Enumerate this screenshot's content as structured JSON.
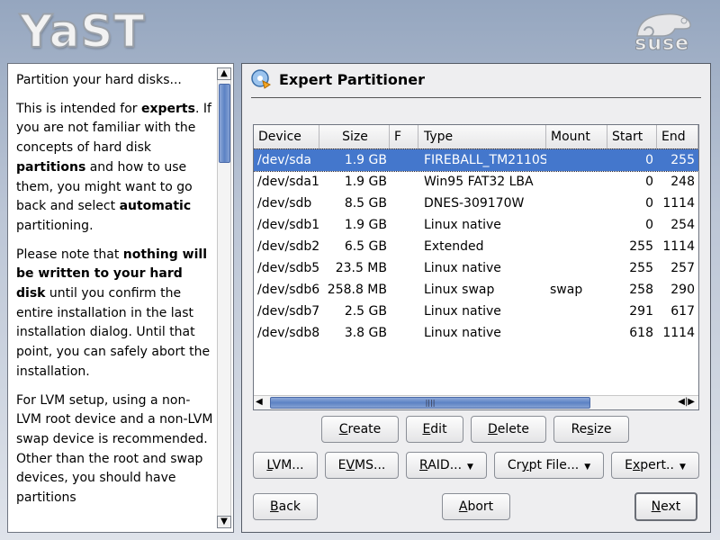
{
  "brand": {
    "logo": "YaST",
    "vendor": "suse"
  },
  "help": {
    "paragraphs": [
      [
        {
          "t": "Partition your hard disks..."
        }
      ],
      [
        {
          "t": "This is intended for "
        },
        {
          "t": "experts",
          "b": true
        },
        {
          "t": ". If you are not familiar with the concepts of hard disk "
        },
        {
          "t": "partitions",
          "b": true
        },
        {
          "t": " and how to use them, you might want to go back and select "
        },
        {
          "t": "automatic",
          "b": true
        },
        {
          "t": " partitioning."
        }
      ],
      [
        {
          "t": "Please note that "
        },
        {
          "t": "nothing will be written to your hard disk",
          "b": true
        },
        {
          "t": " until you confirm the entire installation in the last installation dialog. Until that point, you can safely abort the installation."
        }
      ],
      [
        {
          "t": "For LVM setup, using a non-LVM root device and a non-LVM swap device is recommended. Other than the root and swap devices, you should have partitions"
        }
      ]
    ]
  },
  "dialog": {
    "title": "Expert Partitioner",
    "columns": [
      "Device",
      "Size",
      "F",
      "Type",
      "Mount",
      "Start",
      "End"
    ],
    "rows": [
      {
        "device": "/dev/sda",
        "size": "1.9 GB",
        "f": "",
        "type": "FIREBALL_TM2110S",
        "mount": "",
        "start": "0",
        "end": "255",
        "selected": true
      },
      {
        "device": "/dev/sda1",
        "size": "1.9 GB",
        "f": "",
        "type": "Win95 FAT32 LBA",
        "mount": "",
        "start": "0",
        "end": "248"
      },
      {
        "device": "/dev/sdb",
        "size": "8.5 GB",
        "f": "",
        "type": "DNES-309170W",
        "mount": "",
        "start": "0",
        "end": "1114"
      },
      {
        "device": "/dev/sdb1",
        "size": "1.9 GB",
        "f": "",
        "type": "Linux native",
        "mount": "",
        "start": "0",
        "end": "254"
      },
      {
        "device": "/dev/sdb2",
        "size": "6.5 GB",
        "f": "",
        "type": "Extended",
        "mount": "",
        "start": "255",
        "end": "1114"
      },
      {
        "device": "/dev/sdb5",
        "size": "23.5 MB",
        "f": "",
        "type": "Linux native",
        "mount": "",
        "start": "255",
        "end": "257"
      },
      {
        "device": "/dev/sdb6",
        "size": "258.8 MB",
        "f": "",
        "type": "Linux swap",
        "mount": "swap",
        "start": "258",
        "end": "290"
      },
      {
        "device": "/dev/sdb7",
        "size": "2.5 GB",
        "f": "",
        "type": "Linux native",
        "mount": "",
        "start": "291",
        "end": "617"
      },
      {
        "device": "/dev/sdb8",
        "size": "3.8 GB",
        "f": "",
        "type": "Linux native",
        "mount": "",
        "start": "618",
        "end": "1114"
      }
    ],
    "buttons": {
      "create": {
        "pre": "",
        "u": "C",
        "post": "reate"
      },
      "edit": {
        "pre": "",
        "u": "E",
        "post": "dit"
      },
      "delete": {
        "pre": "",
        "u": "D",
        "post": "elete"
      },
      "resize": {
        "pre": "Re",
        "u": "s",
        "post": "ize"
      },
      "lvm": {
        "pre": "",
        "u": "L",
        "post": "VM..."
      },
      "evms": {
        "pre": "E",
        "u": "V",
        "post": "MS..."
      },
      "raid": {
        "pre": "",
        "u": "R",
        "post": "AID..."
      },
      "crypt": {
        "pre": "Cr",
        "u": "y",
        "post": "pt File..."
      },
      "expert": {
        "pre": "E",
        "u": "x",
        "post": "pert.."
      },
      "back": {
        "pre": "",
        "u": "B",
        "post": "ack"
      },
      "abort": {
        "pre": "",
        "u": "A",
        "post": "bort"
      },
      "next": {
        "pre": "",
        "u": "N",
        "post": "ext"
      }
    }
  },
  "colors": {
    "selection": "#4477cc",
    "scroll_thumb": "#5c82c4"
  }
}
